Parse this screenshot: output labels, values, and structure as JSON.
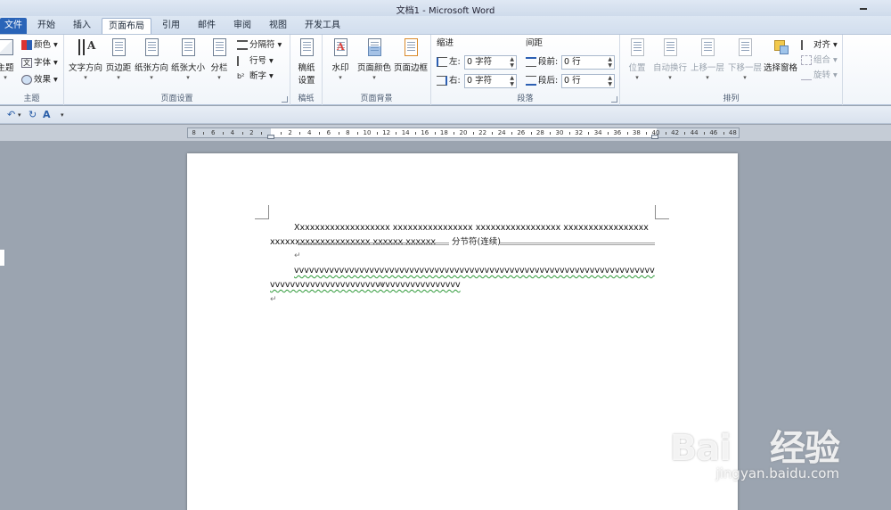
{
  "window": {
    "title": "文档1 - Microsoft Word"
  },
  "tabs": [
    {
      "label": "文件",
      "key": "file"
    },
    {
      "label": "开始",
      "key": "home"
    },
    {
      "label": "插入",
      "key": "insert"
    },
    {
      "label": "页面布局",
      "key": "layout",
      "active": true
    },
    {
      "label": "引用",
      "key": "references"
    },
    {
      "label": "邮件",
      "key": "mailings"
    },
    {
      "label": "审阅",
      "key": "review"
    },
    {
      "label": "视图",
      "key": "view"
    },
    {
      "label": "开发工具",
      "key": "developer"
    }
  ],
  "ribbon": {
    "theme": {
      "label": "主题",
      "themes": "主题",
      "colors": "颜色",
      "fonts": "字体",
      "effects": "效果"
    },
    "page_setup": {
      "label": "页面设置",
      "text_direction": "文字方向",
      "margins": "页边距",
      "orientation": "纸张方向",
      "size": "纸张大小",
      "columns": "分栏",
      "breaks": "分隔符",
      "line_numbers": "行号",
      "hyphenation": "断字"
    },
    "draft": {
      "label": "稿纸",
      "button_line1": "稿纸",
      "button_line2": "设置"
    },
    "page_background": {
      "label": "页面背景",
      "watermark": "水印",
      "page_color": "页面颜色",
      "page_borders": "页面边框"
    },
    "paragraph": {
      "label": "段落",
      "indent_title": "缩进",
      "spacing_title": "间距",
      "left_label": "左:",
      "left_value": "0 字符",
      "right_label": "右:",
      "right_value": "0 字符",
      "before_label": "段前:",
      "before_value": "0 行",
      "after_label": "段后:",
      "after_value": "0 行"
    },
    "arrange": {
      "label": "排列",
      "position": "位置",
      "wrap_text": "自动换行",
      "bring_forward": "上移一层",
      "send_backward": "下移一层",
      "selection_pane": "选择窗格",
      "align": "对齐",
      "group": "组合",
      "rotate": "旋转"
    }
  },
  "ruler": {
    "left_numbers": [
      "8",
      "6",
      "4",
      "2"
    ],
    "right_numbers": [
      "2",
      "4",
      "6",
      "8",
      "10",
      "12",
      "14",
      "16",
      "18",
      "20",
      "22",
      "24",
      "26",
      "28",
      "30",
      "32",
      "34",
      "36",
      "38",
      "40",
      "42",
      "44",
      "46",
      "48"
    ]
  },
  "document": {
    "paragraph1": "Xxxxxxxxxxxxxxxxxxx xxxxxxxxxxxxxxxx xxxxxxxxxxxxxxxxx xxxxxxxxxxxxxxxxx xxxxxxxxxxxxxxxxxxxx xxxxxx xxxxxx",
    "section_break": "分节符(连续)",
    "paragraph2": "vvvvvvvvvvvvvvvvvvvvvvvvvvvvvvvvvvvvvvvvvvvvvvvvvvvvvvvvvvvvvvvvvvvvvvvvvvvvvvvvvvvvvvvvvvvvvvvvvvvvvvvvvvvvvv",
    "para_mark": "↵"
  },
  "watermark": {
    "brand": "Bai",
    "brand2": "经验",
    "url": "jingyan.baidu.com"
  }
}
